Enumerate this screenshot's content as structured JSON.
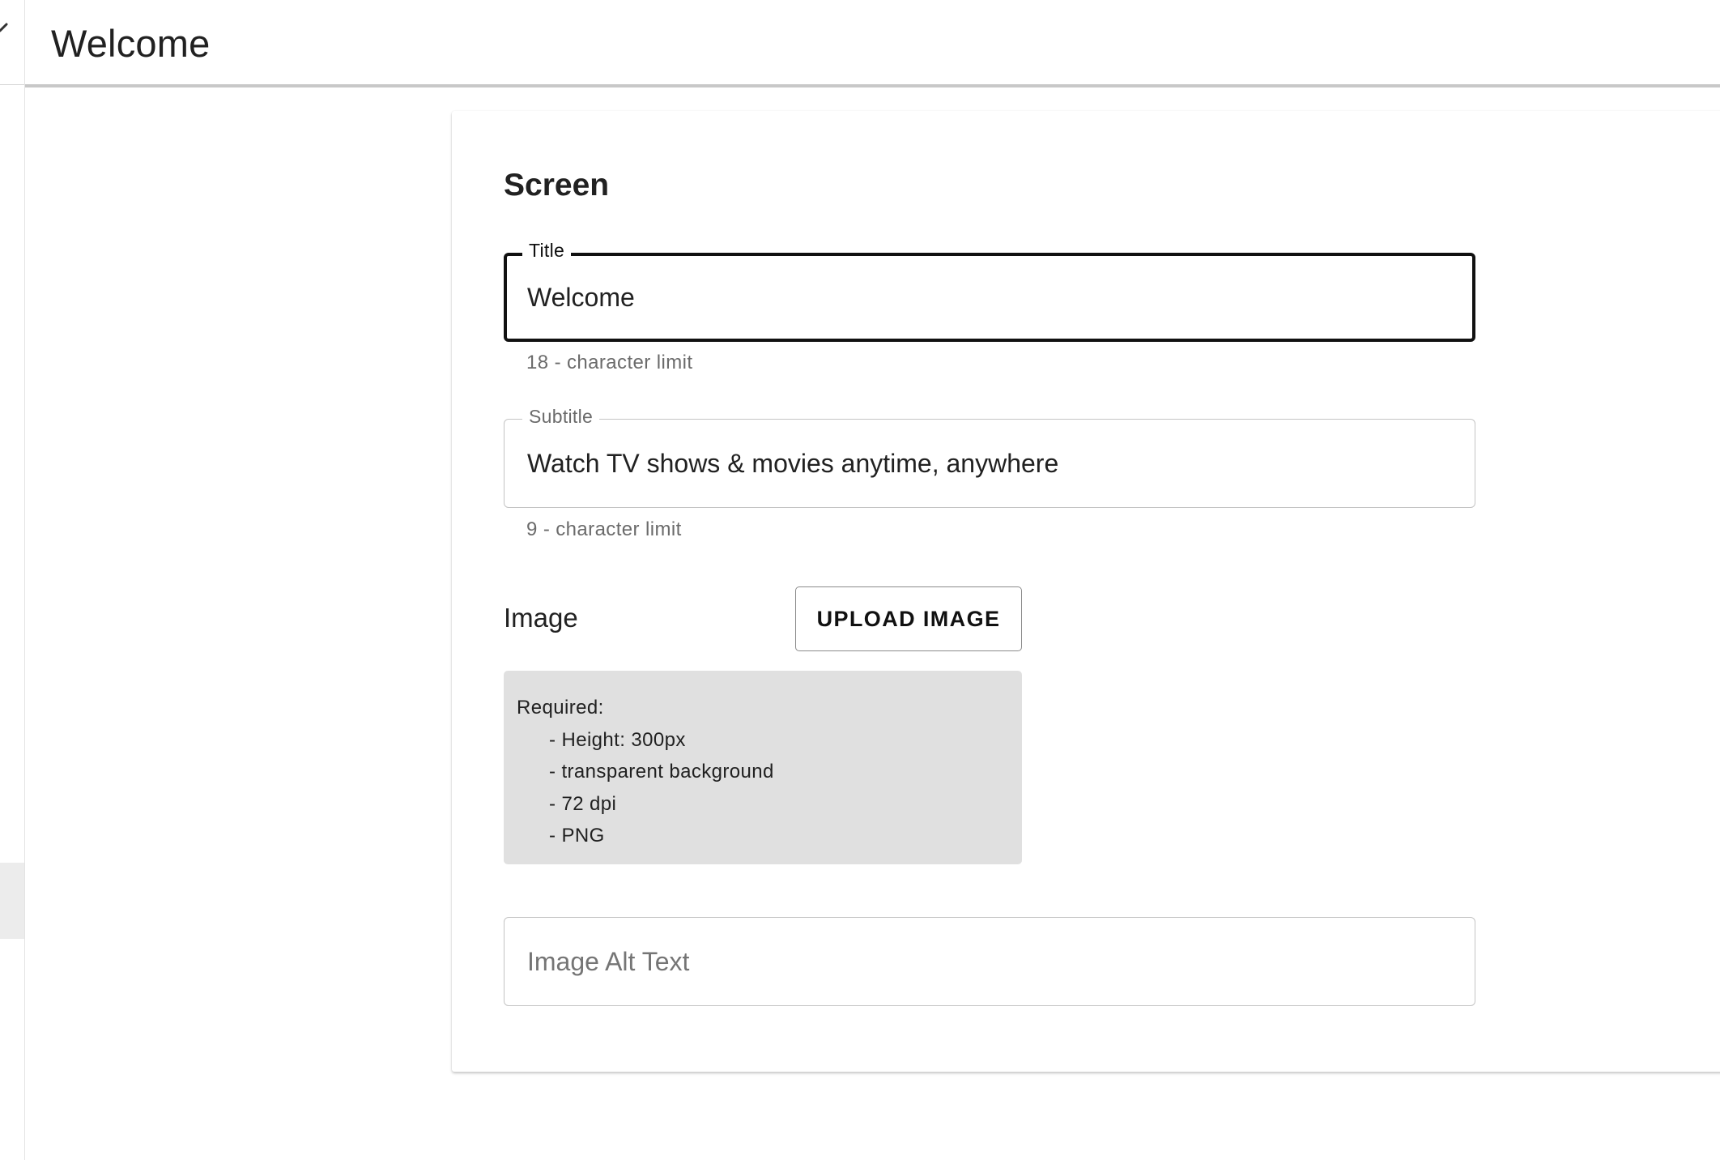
{
  "header": {
    "title": "Welcome"
  },
  "screen": {
    "section_title": "Screen",
    "title_field": {
      "label": "Title",
      "value": "Welcome",
      "helper": "18 - character limit"
    },
    "subtitle_field": {
      "label": "Subtitle",
      "value": "Watch TV shows & movies anytime, anywhere",
      "helper": "9 - character limit"
    },
    "image": {
      "label": "Image",
      "upload_label": "UPLOAD IMAGE",
      "requirements_heading": "Required:",
      "requirements": [
        "- Height: 300px",
        "- transparent background",
        "- 72 dpi",
        "- PNG"
      ]
    },
    "alt_text_field": {
      "placeholder": "Image Alt Text",
      "value": ""
    }
  },
  "colors": {
    "focused_border": "#111111",
    "field_border": "#c4c4c4",
    "requirements_bg": "#e0e0e0",
    "header_divider": "#c8c8c8"
  },
  "icons": {
    "back": "chevron-left-icon"
  }
}
